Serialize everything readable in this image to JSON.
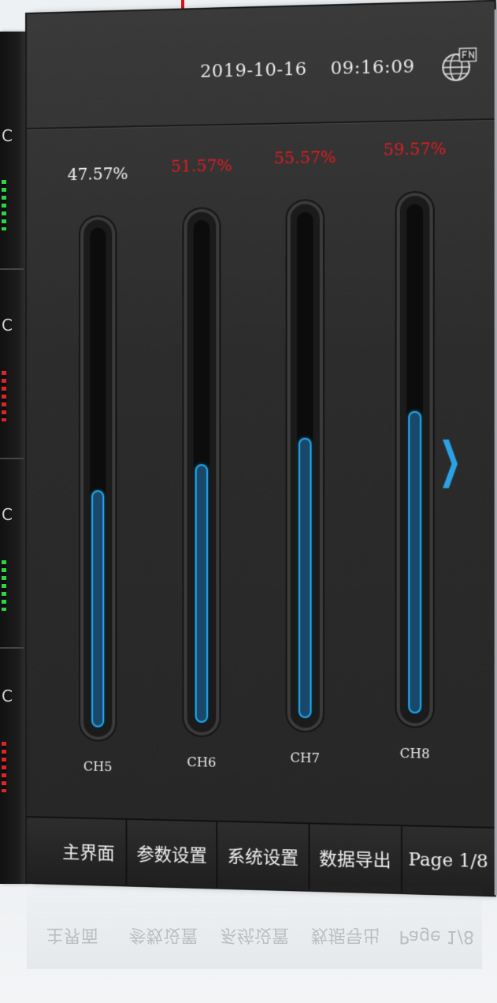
{
  "header": {
    "date": "2019-10-16",
    "time": "09:16:09",
    "logo_icon": "globe-logo-icon"
  },
  "channels": [
    {
      "percent_label": "47.57%",
      "fill": 0.4757,
      "label": "CH5",
      "label_color": "#f1f1f1"
    },
    {
      "percent_label": "51.57%",
      "fill": 0.5157,
      "label": "CH6",
      "label_color": "#e01b22"
    },
    {
      "percent_label": "55.57%",
      "fill": 0.5557,
      "label": "CH7",
      "label_color": "#e01b22"
    },
    {
      "percent_label": "59.57%",
      "fill": 0.5957,
      "label": "CH8",
      "label_color": "#e01b22"
    }
  ],
  "nav": {
    "next_icon": "chevron-right-icon"
  },
  "bottom_bar": {
    "item1": "主界面",
    "item2": "参数设置",
    "item3": "系统设置",
    "item4": "数据导出",
    "page": "Page 1/8"
  },
  "colors": {
    "accent": "#23a6ea",
    "alarm": "#e01b22",
    "text": "#f1f1f1"
  }
}
